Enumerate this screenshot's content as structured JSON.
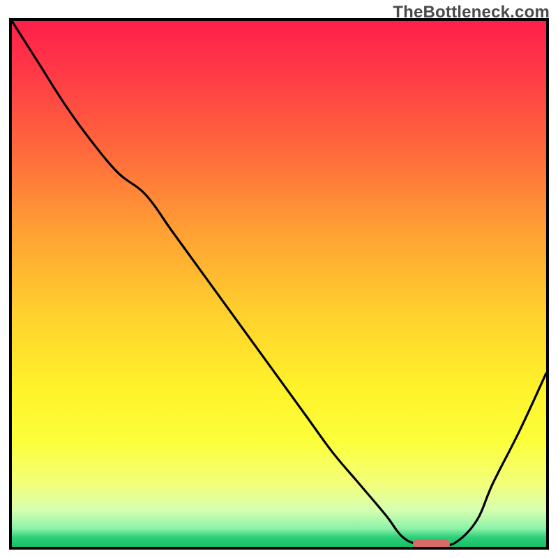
{
  "watermark": "TheBottleneck.com",
  "chart_data": {
    "type": "line",
    "title": "",
    "xlabel": "",
    "ylabel": "",
    "xlim": [
      0,
      100
    ],
    "ylim": [
      0,
      100
    ],
    "grid": false,
    "legend": false,
    "series": [
      {
        "name": "bottleneck-curve",
        "note": "Values are read off of the vertical position of the black curve; x is left→right 0–100, y is bottom→top 0–100.",
        "x": [
          0,
          5,
          10,
          15,
          20,
          25,
          30,
          35,
          40,
          45,
          50,
          55,
          60,
          65,
          70,
          73,
          76,
          80,
          83,
          87,
          90,
          95,
          100
        ],
        "y": [
          100,
          92,
          84,
          77,
          71,
          67,
          60,
          53,
          46,
          39,
          32,
          25,
          18,
          12,
          6,
          2,
          0.5,
          0.5,
          0.8,
          5,
          12,
          22,
          33
        ]
      }
    ],
    "optimum_marker": {
      "note": "Pink rounded bar marking the minimum-bottleneck region along the x-axis (percent of x-range).",
      "x_start": 75,
      "x_end": 82,
      "y": 0.5,
      "color": "#d86a6a"
    },
    "background": {
      "type": "vertical-gradient",
      "stops": [
        {
          "pct": 0,
          "color": "#ff1f4a"
        },
        {
          "pct": 25,
          "color": "#ff6a3c"
        },
        {
          "pct": 55,
          "color": "#ffcf2e"
        },
        {
          "pct": 80,
          "color": "#fbff3a"
        },
        {
          "pct": 96,
          "color": "#8cf2a8"
        },
        {
          "pct": 100,
          "color": "#16c066"
        }
      ]
    }
  }
}
